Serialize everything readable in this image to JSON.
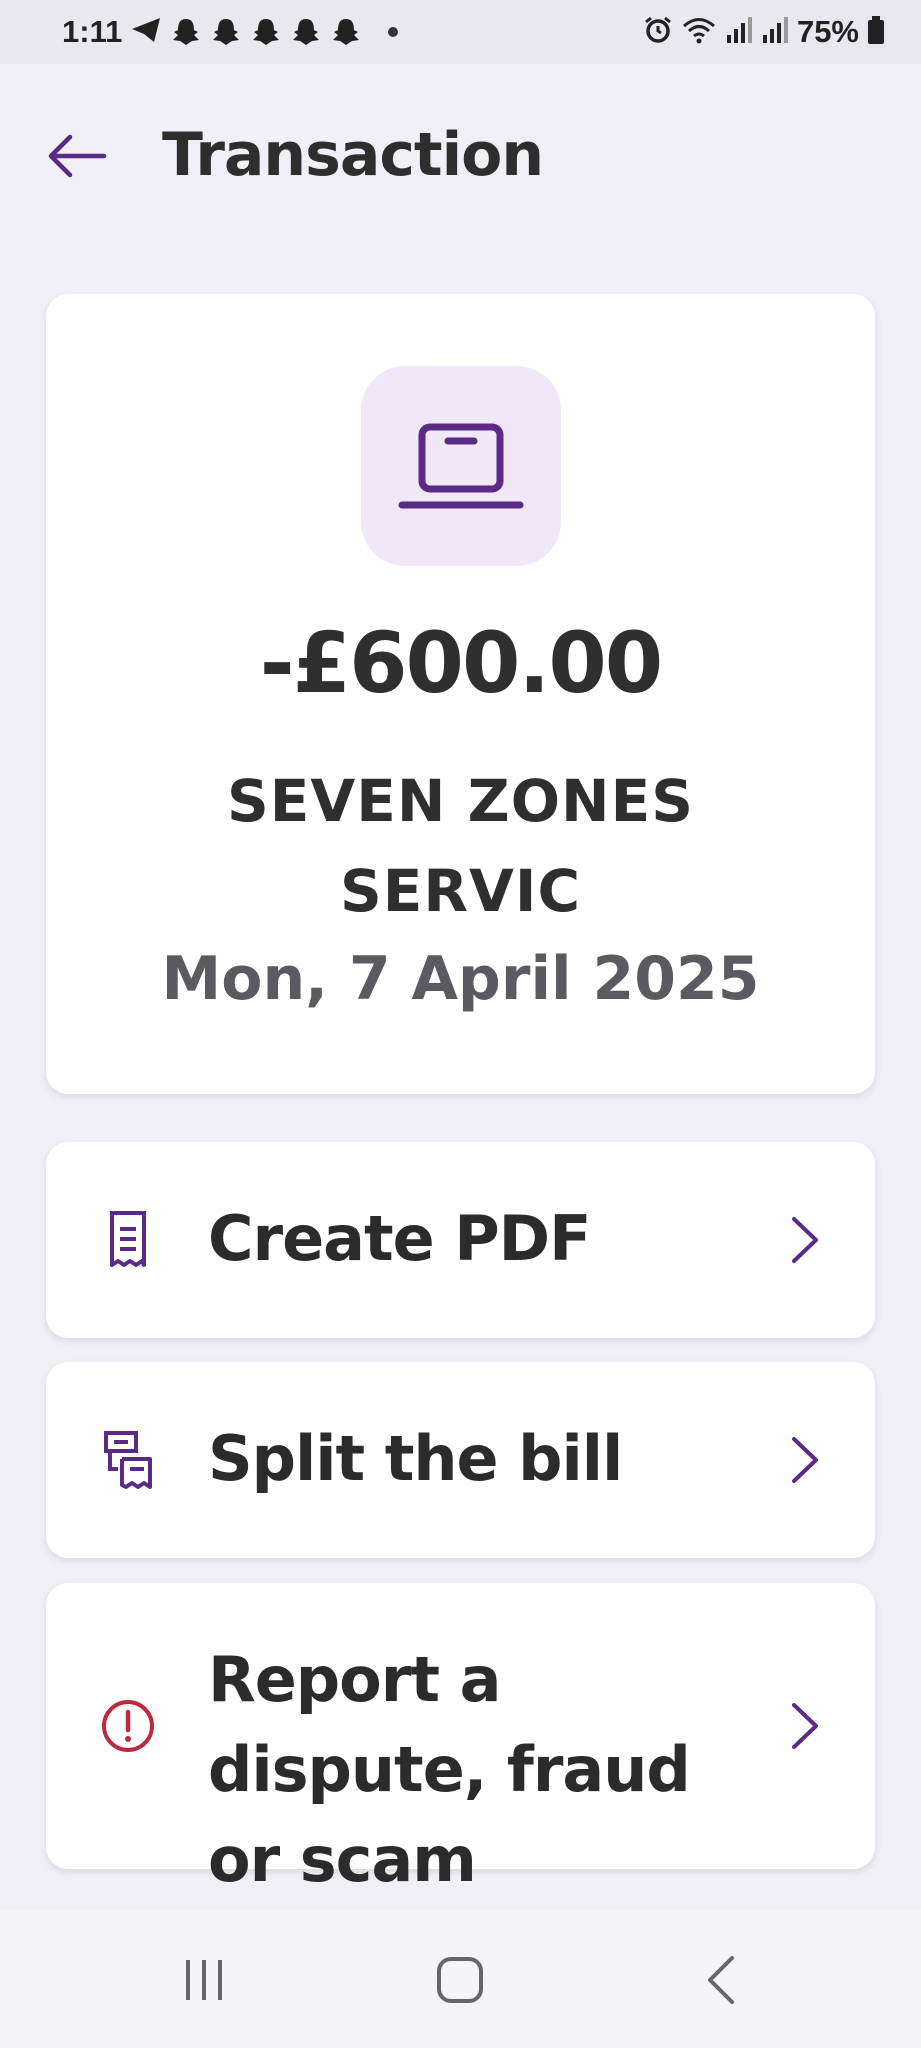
{
  "status_bar": {
    "time": "1:11",
    "battery": "75%"
  },
  "header": {
    "title": "Transaction",
    "back_icon": "arrow-left-icon"
  },
  "transaction": {
    "icon": "laptop-icon",
    "amount": "-£600.00",
    "merchant": "SEVEN ZONES SERVIC",
    "date": "Mon, 7 April 2025"
  },
  "actions": [
    {
      "label": "Create PDF",
      "icon": "receipt-icon"
    },
    {
      "label": "Split the bill",
      "icon": "split-receipt-icon"
    },
    {
      "label": "Report a dispute, fraud or scam",
      "icon": "alert-circle-icon"
    }
  ],
  "colors": {
    "accent_purple": "#5b2a86",
    "icon_bg": "#f0e8f8",
    "alert_red": "#c0283b",
    "background": "#f1f0f6"
  }
}
